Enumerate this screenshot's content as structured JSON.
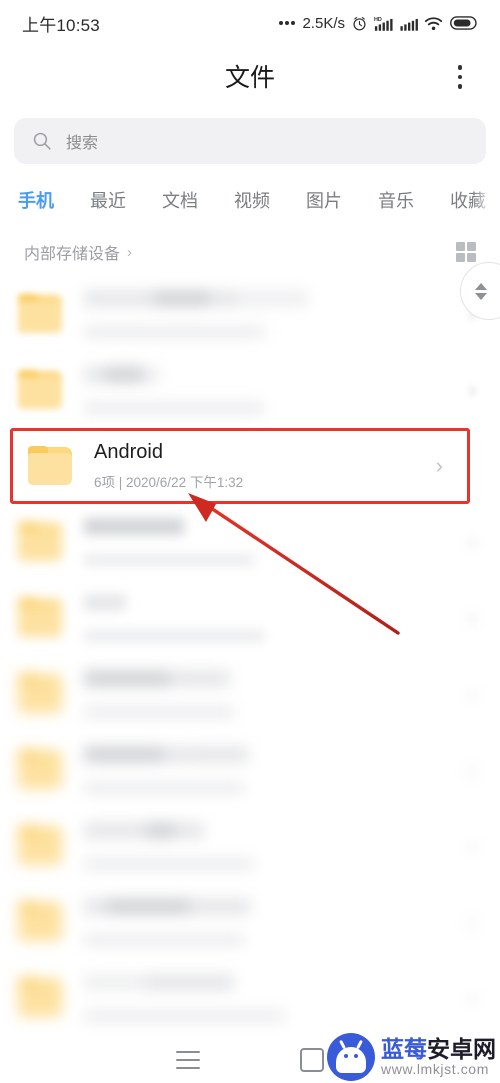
{
  "status_bar": {
    "time": "上午10:53",
    "network_speed": "2.5K/s",
    "icons": [
      "more-dots-icon",
      "alarm-clock-icon",
      "hd-signal-icon",
      "signal-bars-icon",
      "wifi-icon",
      "battery-icon"
    ]
  },
  "header": {
    "title": "文件",
    "more_icon": "overflow-menu-icon"
  },
  "search": {
    "placeholder": "搜索",
    "icon": "search-icon"
  },
  "tabs": [
    {
      "label": "手机",
      "active": true
    },
    {
      "label": "最近",
      "active": false
    },
    {
      "label": "文档",
      "active": false
    },
    {
      "label": "视频",
      "active": false
    },
    {
      "label": "图片",
      "active": false
    },
    {
      "label": "音乐",
      "active": false
    },
    {
      "label": "收藏",
      "active": false
    }
  ],
  "breadcrumb": {
    "label": "内部存储设备",
    "chevron": "›",
    "grid_toggle_icon": "grid-view-icon"
  },
  "file_list": {
    "chevron": "›",
    "rows": [
      {
        "name": "",
        "meta": "",
        "redacted": true,
        "highlighted": false
      },
      {
        "name": "",
        "meta": "",
        "redacted": true,
        "highlighted": false
      },
      {
        "name": "Android",
        "meta": "6项 | 2020/6/22 下午1:32",
        "redacted": false,
        "highlighted": true
      },
      {
        "name": "",
        "meta": "",
        "redacted": true,
        "highlighted": false
      },
      {
        "name": "",
        "meta": "",
        "redacted": true,
        "highlighted": false
      },
      {
        "name": "",
        "meta": "",
        "redacted": true,
        "highlighted": false
      },
      {
        "name": "",
        "meta": "",
        "redacted": true,
        "highlighted": false
      },
      {
        "name": "",
        "meta": "",
        "redacted": true,
        "highlighted": false
      },
      {
        "name": "",
        "meta": "",
        "redacted": true,
        "highlighted": false
      },
      {
        "name": "",
        "meta": "",
        "redacted": true,
        "highlighted": false
      }
    ]
  },
  "annotation": {
    "highlight_color": "#e8342a",
    "arrow_color": "#cc2222"
  },
  "scroll_thumb": {
    "icon": "scroll-updown-icon"
  },
  "nav_bar": {
    "menu_icon": "menu-icon",
    "home_icon": "square-home-icon"
  },
  "watermark": {
    "brand_blue": "蓝莓",
    "brand_dark": "安卓网",
    "url": "www.lmkjst.com",
    "logo_icon": "android-robot-logo-icon",
    "logo_color": "#3a5bd9"
  }
}
